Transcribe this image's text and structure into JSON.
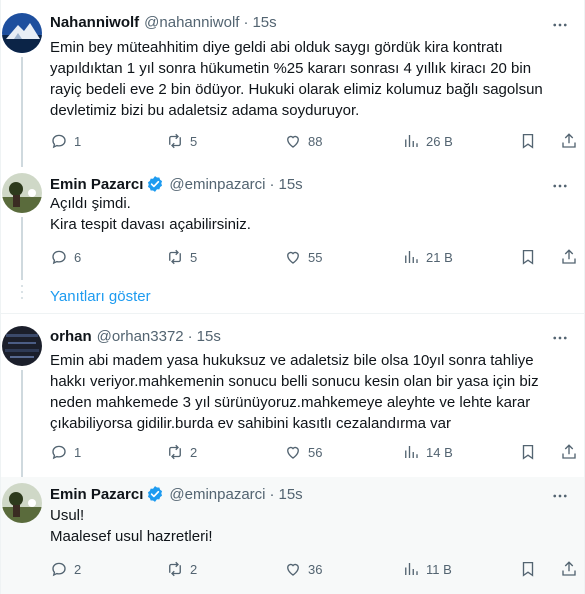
{
  "tweets": [
    {
      "name": "Nahanniwolf",
      "handle": "@nahanniwolf",
      "time": "15s",
      "verified": false,
      "lines": [
        "Emin bey müteahhitim diye geldi abi olduk saygı gördük kira kontratı",
        "yapıldıktan 1 yıl sonra hükumetin %25 kararı sonrası 4 yıllık kiracı 20 bin",
        "rayiç bedeli eve 2 bin ödüyor. Hukuki olarak elimiz kolumuz bağlı sagolsun",
        "devletimiz bizi bu adaletsiz adama soyduruyor."
      ],
      "replies": "1",
      "retweets": "5",
      "likes": "88",
      "views": "26 B"
    },
    {
      "name": "Emin Pazarcı",
      "handle": "@eminpazarci",
      "time": "15s",
      "verified": true,
      "lines": [
        "Açıldı şimdi.",
        "Kira tespit davası açabilirsiniz."
      ],
      "replies": "6",
      "retweets": "5",
      "likes": "55",
      "views": "21 B"
    },
    {
      "name": "orhan",
      "handle": "@orhan3372",
      "time": "15s",
      "verified": false,
      "lines": [
        "Emin abi madem yasa  hukuksuz ve adaletsiz bile olsa 10yıl sonra tahliye",
        "hakkı veriyor.mahkemenin sonucu belli sonucu kesin olan bir yasa için biz",
        "neden mahkemede 3 yıl sürünüyoruz.mahkemeye aleyhte ve lehte karar",
        "çıkabiliyorsa gidilir.burda ev sahibini kasıtlı cezalandırma var"
      ],
      "replies": "1",
      "retweets": "2",
      "likes": "56",
      "views": "14 B"
    },
    {
      "name": "Emin Pazarcı",
      "handle": "@eminpazarci",
      "time": "15s",
      "verified": true,
      "lines": [
        "Usul!",
        "Maalesef usul hazretleri!"
      ],
      "replies": "2",
      "retweets": "2",
      "likes": "36",
      "views": "11 B"
    }
  ],
  "show_replies": "Yanıtları göster",
  "colors": {
    "text": "#0f1419",
    "secondary": "#536471",
    "accent": "#1d9bf0",
    "divider": "#eff3f4",
    "highlight_bg": "#f7f9f9"
  },
  "icons": [
    "reply-icon",
    "retweet-icon",
    "like-icon",
    "views-icon",
    "bookmark-icon",
    "share-icon",
    "more-icon",
    "verified-icon"
  ]
}
